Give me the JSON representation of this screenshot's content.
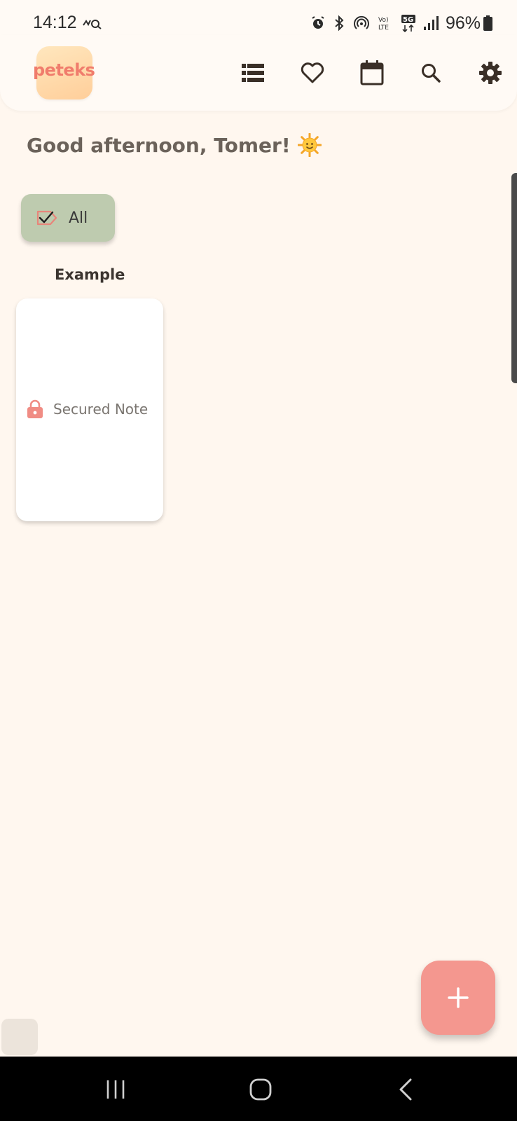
{
  "status_bar": {
    "time": "14:12",
    "battery": "96%",
    "icons": [
      "alarm-icon",
      "bluetooth-icon",
      "hotspot-icon",
      "volte-icon",
      "5g-icon",
      "signal-icon",
      "battery-icon"
    ]
  },
  "header": {
    "logo_text": "peteks",
    "icons": [
      "list-view-icon",
      "favorites-heart-icon",
      "calendar-icon",
      "search-icon",
      "settings-gear-icon"
    ]
  },
  "greeting": {
    "text": "Good afternoon, Tomer!",
    "emoji": "🌞"
  },
  "filter": {
    "chip_label": "All",
    "chip_icon": "tag-check-icon",
    "chip_color": "#BECBAF"
  },
  "section": {
    "title": "Example"
  },
  "notes": [
    {
      "label": "Secured Note",
      "icon": "lock-icon"
    }
  ],
  "fab": {
    "icon": "plus-icon",
    "color": "#F4978F"
  },
  "nav": {
    "icons": [
      "recent-apps-icon",
      "home-icon",
      "back-icon"
    ]
  },
  "colors": {
    "background": "#FFF7EF",
    "accent": "#F07C6C",
    "text_dark": "#3b3530"
  }
}
